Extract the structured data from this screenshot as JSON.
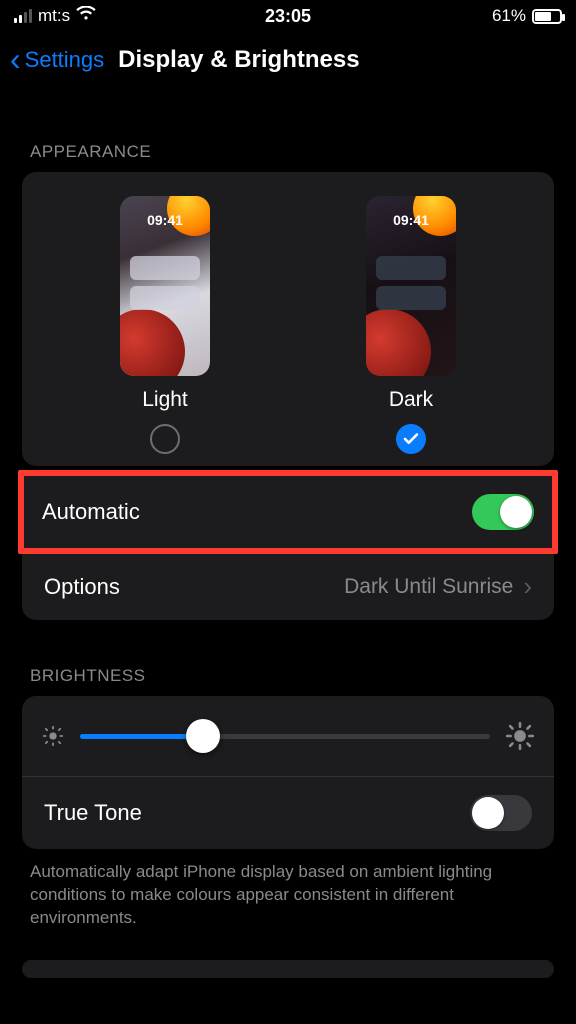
{
  "status_bar": {
    "carrier": "mt:s",
    "time": "23:05",
    "battery_percent": "61%"
  },
  "nav": {
    "back_label": "Settings",
    "page_title": "Display & Brightness"
  },
  "appearance": {
    "header": "APPEARANCE",
    "preview_time": "09:41",
    "light_label": "Light",
    "dark_label": "Dark",
    "automatic_label": "Automatic",
    "options_label": "Options",
    "options_value": "Dark Until Sunrise"
  },
  "brightness": {
    "header": "BRIGHTNESS",
    "true_tone_label": "True Tone",
    "footer": "Automatically adapt iPhone display based on ambient lighting conditions to make colours appear consistent in different environments."
  }
}
